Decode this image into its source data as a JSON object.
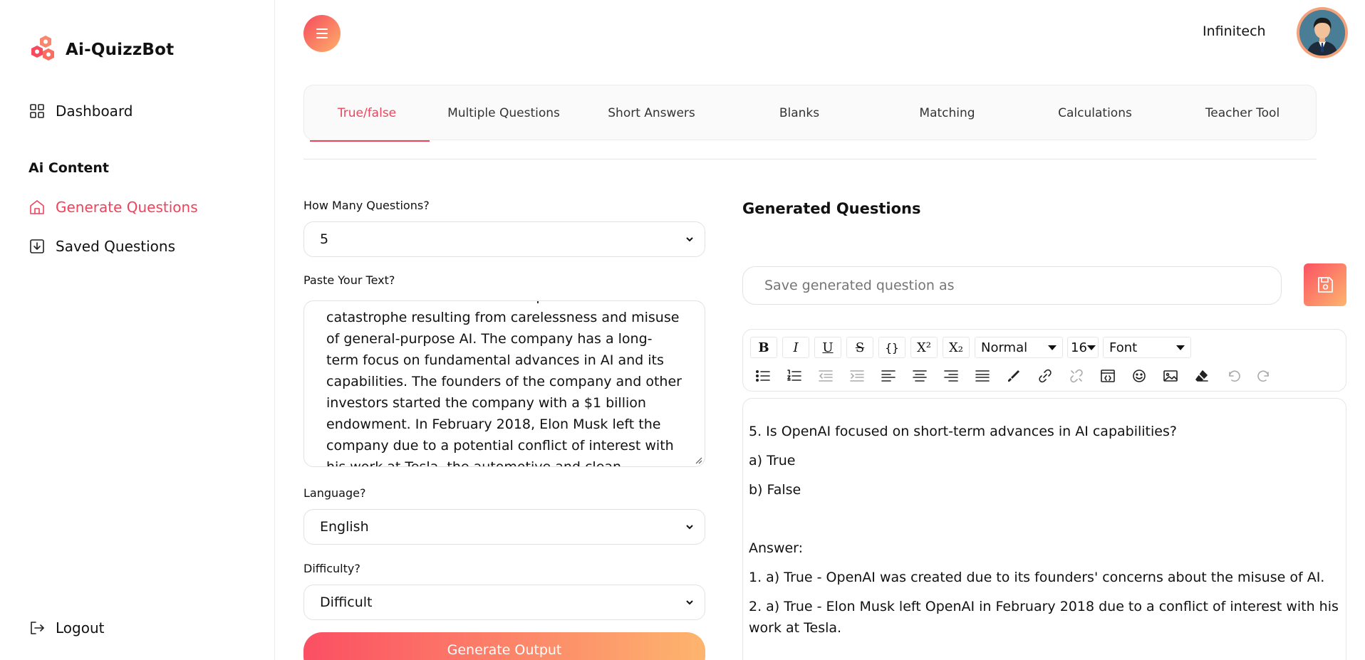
{
  "brand": {
    "name": "Ai-QuizzBot"
  },
  "sidebar": {
    "dashboard": "Dashboard",
    "section": "Ai Content",
    "generate": "Generate Questions",
    "saved": "Saved Questions",
    "logout": "Logout"
  },
  "header": {
    "user": "Infinitech"
  },
  "tabs": [
    "True/false",
    "Multiple Questions",
    "Short Answers",
    "Blanks",
    "Matching",
    "Calculations",
    "Teacher Tool"
  ],
  "active_tab": "True/false",
  "form": {
    "count_label": "How Many Questions?",
    "count_value": "5",
    "text_label": "Paste Your Text?",
    "text_lines": [
      "existential concerns about the potential for",
      "catastrophe resulting from carelessness and misuse",
      "of general-purpose AI. The company has a long-",
      "term focus on fundamental advances in AI and its",
      "capabilities. The founders of the company and other",
      "investors started the company with a $1 billion",
      "endowment. In February 2018, Elon Musk left the",
      "company due to a potential conflict of interest with",
      "his work at Tesla, the automotive and clean"
    ],
    "language_label": "Language?",
    "language_value": "English",
    "difficulty_label": "Difficulty?",
    "difficulty_value": "Difficult",
    "generate_button": "Generate Output"
  },
  "output": {
    "title": "Generated Questions",
    "save_placeholder": "Save generated question as",
    "toolbar": {
      "bold": "B",
      "italic": "I",
      "underline": "U",
      "strike": "S",
      "code": "{}",
      "superscript": "X²",
      "subscript": "X₂",
      "style": "Normal",
      "size": "16",
      "font": "Font"
    },
    "editor_lines": [
      "5. Is OpenAI focused on short-term advances in AI capabilities?",
      "a) True",
      "b) False",
      "Answer:",
      "1. a) True - OpenAI was created due to its founders' concerns about the misuse of AI.",
      "2. a) True - Elon Musk left OpenAI in February 2018 due to a conflict of interest with his",
      "work at Tesla."
    ]
  },
  "colors": {
    "accent": "#f0435b",
    "gradient_start": "#fb4f63",
    "gradient_end": "#fdb56e"
  }
}
